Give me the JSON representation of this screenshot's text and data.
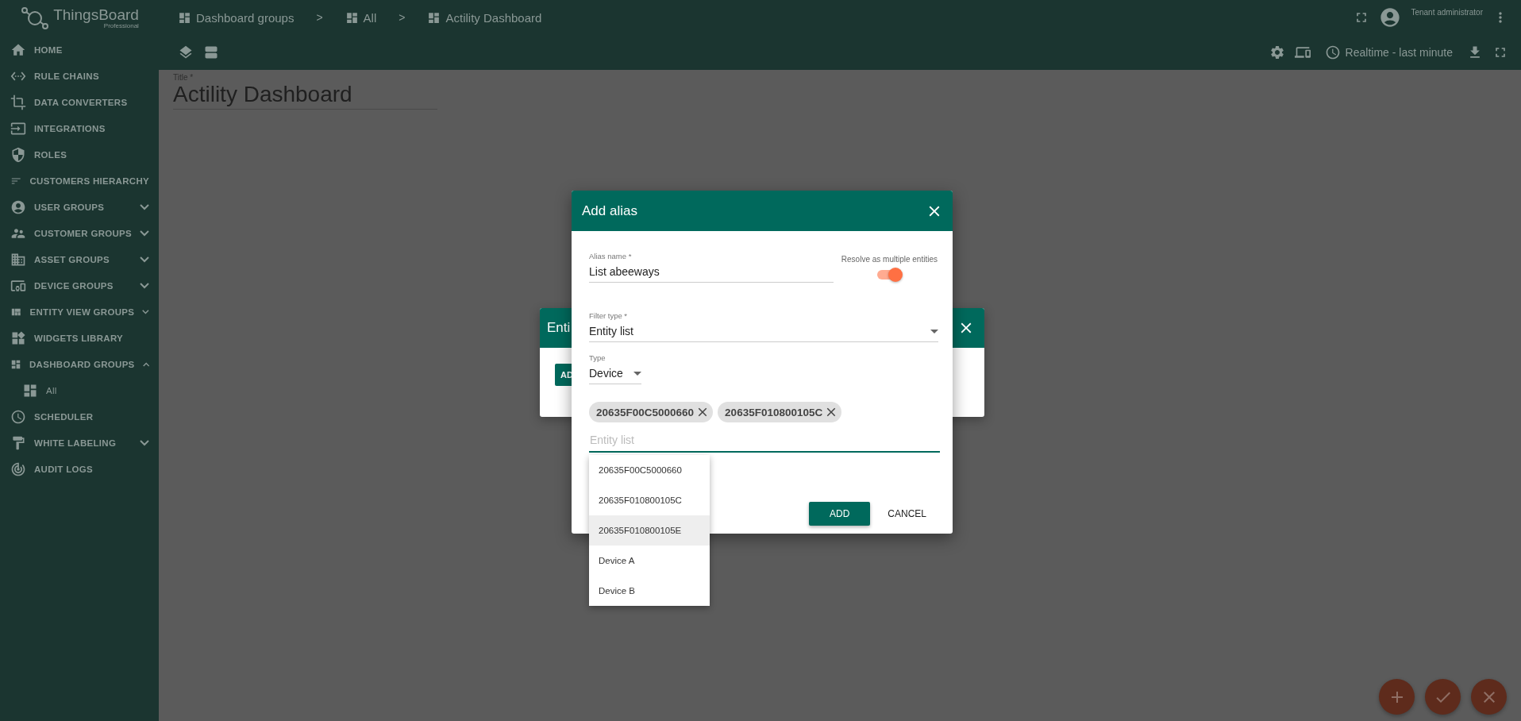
{
  "sidebar": {
    "logo": {
      "name": "ThingsBoard",
      "edition": "Professional"
    },
    "items": [
      {
        "label": "HOME",
        "kind": "link"
      },
      {
        "label": "RULE CHAINS",
        "kind": "link"
      },
      {
        "label": "DATA CONVERTERS",
        "kind": "link"
      },
      {
        "label": "INTEGRATIONS",
        "kind": "link"
      },
      {
        "label": "ROLES",
        "kind": "link"
      },
      {
        "label": "CUSTOMERS HIERARCHY",
        "kind": "link"
      },
      {
        "label": "USER GROUPS",
        "kind": "group",
        "expanded": false
      },
      {
        "label": "CUSTOMER GROUPS",
        "kind": "group",
        "expanded": false
      },
      {
        "label": "ASSET GROUPS",
        "kind": "group",
        "expanded": false
      },
      {
        "label": "DEVICE GROUPS",
        "kind": "group",
        "expanded": false
      },
      {
        "label": "ENTITY VIEW GROUPS",
        "kind": "group",
        "expanded": false
      },
      {
        "label": "WIDGETS LIBRARY",
        "kind": "link"
      },
      {
        "label": "DASHBOARD GROUPS",
        "kind": "group",
        "expanded": true,
        "children": [
          {
            "label": "All"
          }
        ]
      },
      {
        "label": "SCHEDULER",
        "kind": "link"
      },
      {
        "label": "WHITE LABELING",
        "kind": "group",
        "expanded": false
      },
      {
        "label": "AUDIT LOGS",
        "kind": "link"
      }
    ]
  },
  "toolbar": {
    "breadcrumbs": [
      {
        "label": "Dashboard groups",
        "separator": ">"
      },
      {
        "label": "All",
        "separator": ">"
      },
      {
        "label": "Actility Dashboard"
      }
    ],
    "user_role": "Tenant administrator",
    "timewindow": "Realtime - last minute"
  },
  "title_field": {
    "label": "Title *",
    "value": "Actility Dashboard"
  },
  "background_dialog": {
    "title": "Enti",
    "button": "AD"
  },
  "alias_dialog": {
    "title": "Add alias",
    "alias_name": {
      "label": "Alias name *",
      "value": "List abeeways"
    },
    "resolve_multiple": {
      "label": "Resolve as multiple entities",
      "on": true
    },
    "filter_type": {
      "label": "Filter type *",
      "value": "Entity list"
    },
    "type": {
      "label": "Type",
      "value": "Device"
    },
    "chips": [
      "20635F00C5000660",
      "20635F010800105C"
    ],
    "entity_input": {
      "placeholder": "Entity list"
    },
    "options": [
      {
        "label": "20635F00C5000660",
        "selected": false
      },
      {
        "label": "20635F010800105C",
        "selected": false
      },
      {
        "label": "20635F010800105E",
        "selected": true
      },
      {
        "label": "Device A",
        "selected": false
      },
      {
        "label": "Device B",
        "selected": false
      }
    ],
    "buttons": [
      {
        "label": "ADD",
        "kind": "primary"
      },
      {
        "label": "CANCEL",
        "kind": "flat"
      }
    ]
  }
}
